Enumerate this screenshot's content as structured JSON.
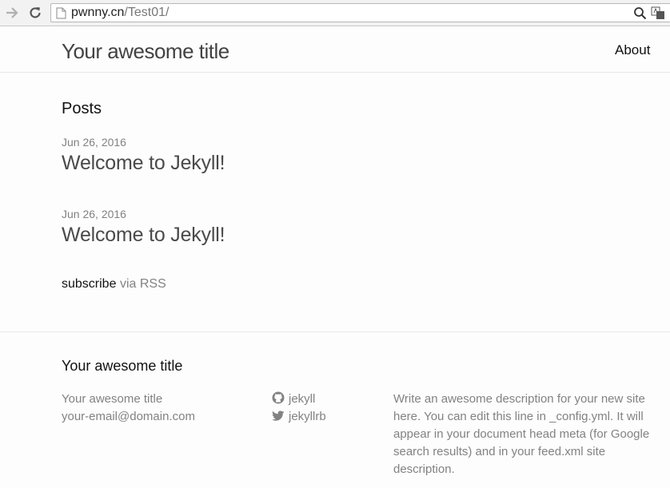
{
  "browser": {
    "url_host": "pwnny.cn",
    "url_path": "/Test01/"
  },
  "header": {
    "site_title": "Your awesome title",
    "nav_about": "About"
  },
  "main": {
    "posts_heading": "Posts",
    "posts": [
      {
        "date": "Jun 26, 2016",
        "title": "Welcome to Jekyll!"
      },
      {
        "date": "Jun 26, 2016",
        "title": "Welcome to Jekyll!"
      }
    ],
    "rss_subscribe": "subscribe",
    "rss_via": "via RSS"
  },
  "footer": {
    "heading": "Your awesome title",
    "site_name": "Your awesome title",
    "email": "your-email@domain.com",
    "github": "jekyll",
    "twitter": "jekyllrb",
    "description": "Write an awesome description for your new site here. You can edit this line in _config.yml. It will appear in your document head meta (for Google search results) and in your feed.xml site description."
  }
}
